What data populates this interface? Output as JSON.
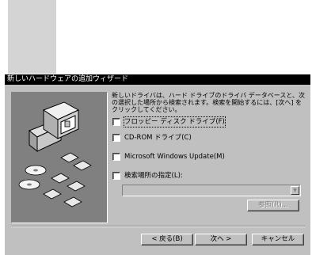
{
  "window": {
    "title": "新しいハードウェアの追加ウィザード"
  },
  "description": "新しいドライバは、ハード ドライブのドライバ データベースと、次の選択した場所から検索されます。検索を開始するには、[次へ] をクリックしてください。",
  "options": [
    {
      "label": "フロッピー ディスク ドライブ",
      "accel": "(F)",
      "checked": false,
      "focused": true
    },
    {
      "label": "CD-ROM ドライブ",
      "accel": "(C)",
      "checked": false,
      "focused": false
    },
    {
      "label": "Microsoft Windows Update",
      "accel": "(M)",
      "checked": false,
      "focused": false
    },
    {
      "label": "検索場所の指定",
      "accel": "(L):",
      "checked": false,
      "focused": false
    }
  ],
  "location_combo": {
    "value": ""
  },
  "browse_button": "参照(R)...",
  "nav": {
    "back": "< 戻る(B)",
    "next": "次へ >",
    "cancel": "キャンセル"
  },
  "colors": {
    "dialog_face": "#c0c0c0",
    "titlebar": "#000000",
    "art_panel": "#808080"
  }
}
